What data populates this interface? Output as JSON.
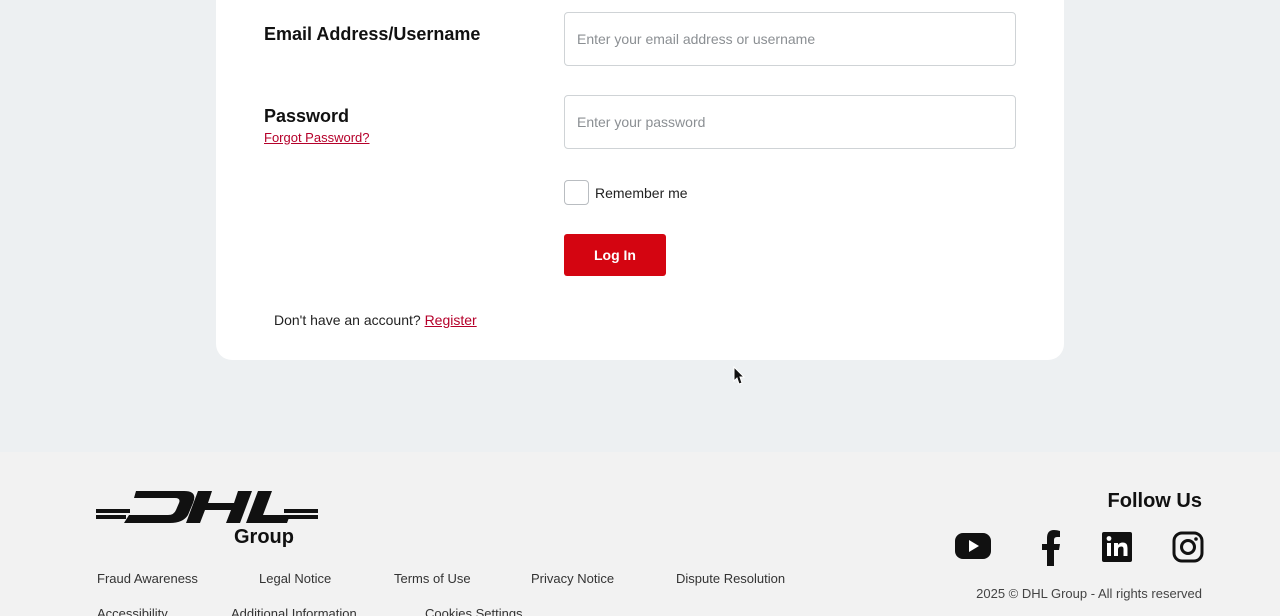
{
  "form": {
    "email_label": "Email Address/Username",
    "email_placeholder": "Enter your email address or username",
    "password_label": "Password",
    "forgot_password": "Forgot Password?",
    "password_placeholder": "Enter your password",
    "remember_me": "Remember me",
    "login_button": "Log In",
    "no_account_text": "Don't have an account?",
    "register_link": "Register"
  },
  "footer": {
    "logo_text": "DHL",
    "logo_group": "Group",
    "links_row1": [
      "Fraud Awareness",
      "Legal Notice",
      "Terms of Use",
      "Privacy Notice",
      "Dispute Resolution"
    ],
    "links_row2": [
      "Accessibility",
      "Additional Information",
      "Cookies Settings"
    ],
    "follow_us": "Follow Us",
    "social_icons": [
      "youtube-icon",
      "facebook-icon",
      "linkedin-icon",
      "instagram-icon"
    ],
    "copyright": "2025 © DHL Group - All rights reserved"
  },
  "colors": {
    "brand_red": "#d40511",
    "link_red": "#b5002a",
    "page_bg": "#edf0f2"
  }
}
